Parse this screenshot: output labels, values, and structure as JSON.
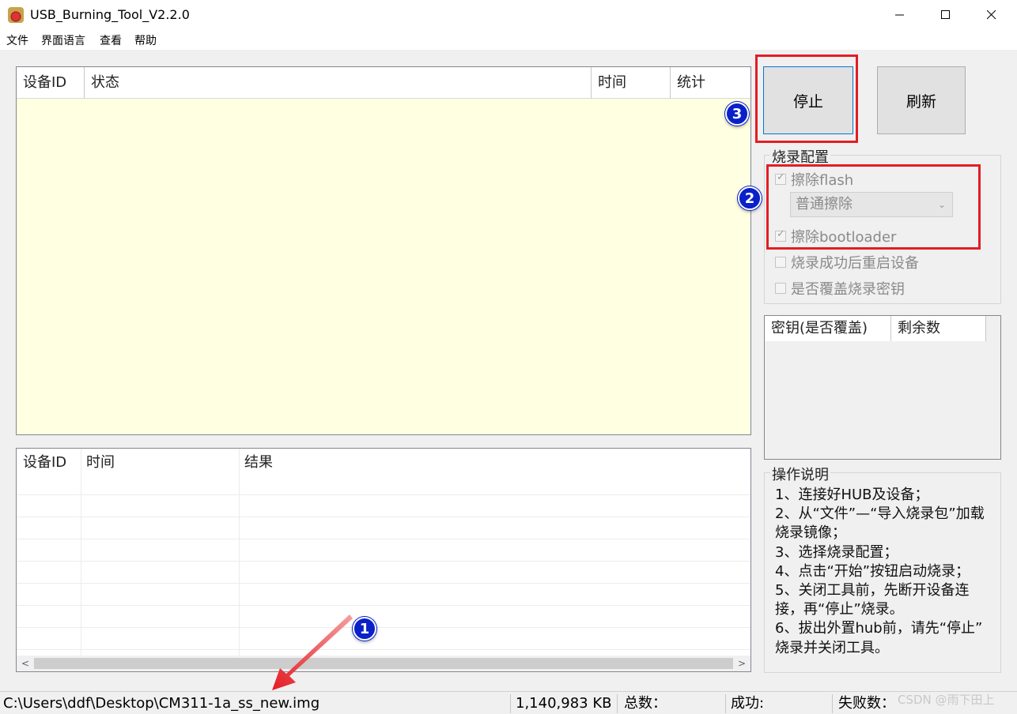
{
  "window": {
    "title": "USB_Burning_Tool_V2.2.0",
    "minimize_glyph": "—",
    "maximize_glyph": "☐",
    "close_glyph": "✕"
  },
  "menu": [
    "文件",
    "界面语言",
    "查看",
    "帮助"
  ],
  "device_table": {
    "columns": [
      "设备ID",
      "状态",
      "时间",
      "统计"
    ],
    "background": "#ffffe1"
  },
  "result_table": {
    "columns": [
      "设备ID",
      "时间",
      "结果"
    ]
  },
  "buttons": {
    "stop": "停止",
    "refresh": "刷新"
  },
  "burn_config": {
    "title": "烧录配置",
    "erase_flash": {
      "label": "擦除flash",
      "checked": true,
      "disabled": true
    },
    "erase_mode": "普通擦除",
    "erase_bootloader": {
      "label": "擦除bootloader",
      "checked": true,
      "disabled": true
    },
    "reboot_after": {
      "label": "烧录成功后重启设备",
      "checked": false,
      "disabled": true
    },
    "overwrite_key": {
      "label": "是否覆盖烧录密钥",
      "checked": false,
      "disabled": true
    }
  },
  "key_table": {
    "columns": [
      "密钥(是否覆盖)",
      "剩余数"
    ]
  },
  "instructions": {
    "title": "操作说明",
    "lines": [
      "1、连接好HUB及设备；",
      "2、从“文件”—“导入烧录包”加载",
      "烧录镜像；",
      "3、选择烧录配置；",
      "4、点击“开始”按钮启动烧录；",
      "5、关闭工具前，先断开设备连",
      "接，再“停止”烧录。",
      "6、拔出外置hub前，请先“停止”",
      "烧录并关闭工具。"
    ]
  },
  "status_bar": {
    "path": "C:\\Users\\ddf\\Desktop\\CM311-1a_ss_new.img",
    "size": "1,140,983 KB",
    "total": "总数：",
    "success": "成功:",
    "fail": "失败数："
  },
  "annotations": {
    "badge_1": "1",
    "badge_2": "2",
    "badge_3": "3",
    "color": "#e31d24",
    "badge_color": "#0a20c8"
  },
  "watermark": "CSDN @雨下田上"
}
